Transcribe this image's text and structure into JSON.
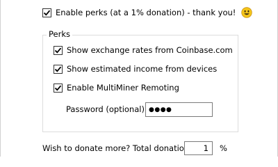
{
  "enable_perks": {
    "label": "Enable perks (at a 1% donation) - thank you!",
    "checked": true,
    "emoji_icon": "smiley-icon"
  },
  "perks_group": {
    "title": "Perks",
    "options": [
      {
        "label": "Show exchange rates from Coinbase.com",
        "checked": true
      },
      {
        "label": "Show estimated income from devices",
        "checked": true
      },
      {
        "label": "Enable MultiMiner Remoting",
        "checked": true
      }
    ],
    "password": {
      "label": "Password (optional):",
      "value_masked": "●●●●"
    }
  },
  "donation": {
    "label": "Wish to donate more? Total donation:",
    "value": "1",
    "unit": "%"
  },
  "colors": {
    "border": "#dcdcdc",
    "text": "#000000",
    "smiley": "#f5c518"
  }
}
